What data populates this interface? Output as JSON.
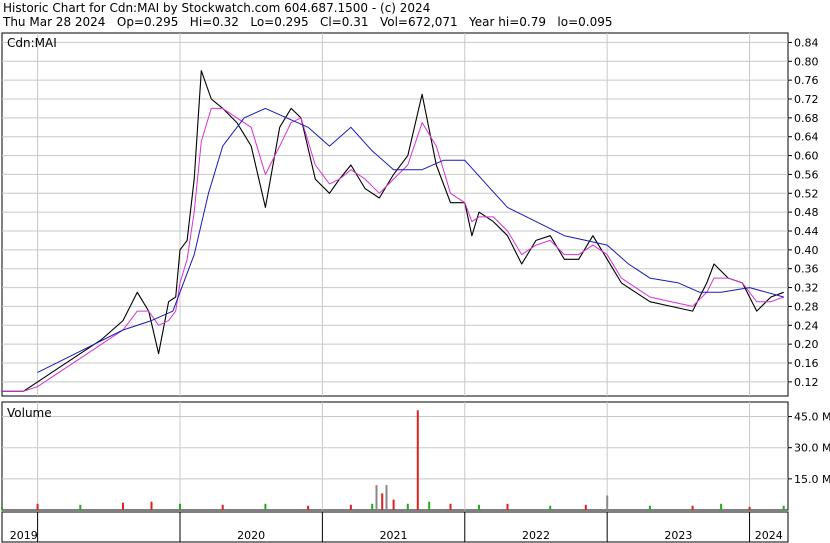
{
  "header": {
    "title": "Historic Chart for Cdn:MAI by Stockwatch.com 604.687.1500 - (c) 2024",
    "quote_line": "Thu Mar 28 2024   Op=0.295   Hi=0.32   Lo=0.295   Cl=0.31   Vol=672,071   Year hi=0.79   lo=0.095"
  },
  "colors": {
    "price": "#000000",
    "ma_short": "#d633d6",
    "ma_long": "#1a1ab8",
    "volume_up": "#22aa22",
    "volume_down": "#dd2222",
    "volume_other": "#888888",
    "grid": "#c8c8c8"
  },
  "chart_data": [
    {
      "type": "line",
      "panel": "price",
      "label": "Cdn:MAI",
      "ylim": [
        0.09,
        0.86
      ],
      "y_ticks": [
        "0.84",
        "0.80",
        "0.76",
        "0.72",
        "0.68",
        "0.64",
        "0.60",
        "0.56",
        "0.52",
        "0.48",
        "0.44",
        "0.40",
        "0.36",
        "0.32",
        "0.28",
        "0.24",
        "0.20",
        "0.16",
        "0.12"
      ],
      "x_ticks": [
        "2019",
        "2020",
        "2021",
        "2022",
        "2023",
        "2024"
      ],
      "series": [
        {
          "key": "close",
          "x": [
            2018.75,
            2018.9,
            2019.0,
            2019.15,
            2019.3,
            2019.45,
            2019.6,
            2019.7,
            2019.78,
            2019.85,
            2019.92,
            2019.97,
            2020.0,
            2020.05,
            2020.1,
            2020.15,
            2020.22,
            2020.3,
            2020.4,
            2020.5,
            2020.6,
            2020.7,
            2020.78,
            2020.85,
            2020.95,
            2021.05,
            2021.12,
            2021.2,
            2021.3,
            2021.4,
            2021.5,
            2021.6,
            2021.7,
            2021.8,
            2021.9,
            2022.0,
            2022.05,
            2022.1,
            2022.2,
            2022.3,
            2022.4,
            2022.5,
            2022.6,
            2022.7,
            2022.8,
            2022.9,
            2023.0,
            2023.1,
            2023.2,
            2023.3,
            2023.45,
            2023.6,
            2023.7,
            2023.75,
            2023.85,
            2023.95,
            2024.05,
            2024.15,
            2024.24
          ],
          "y": [
            0.1,
            0.1,
            0.12,
            0.15,
            0.18,
            0.21,
            0.25,
            0.31,
            0.27,
            0.18,
            0.29,
            0.3,
            0.4,
            0.42,
            0.55,
            0.78,
            0.72,
            0.7,
            0.67,
            0.62,
            0.49,
            0.66,
            0.7,
            0.68,
            0.55,
            0.52,
            0.55,
            0.58,
            0.53,
            0.51,
            0.56,
            0.6,
            0.73,
            0.58,
            0.5,
            0.5,
            0.43,
            0.48,
            0.46,
            0.43,
            0.37,
            0.42,
            0.43,
            0.38,
            0.38,
            0.43,
            0.38,
            0.33,
            0.31,
            0.29,
            0.28,
            0.27,
            0.33,
            0.37,
            0.34,
            0.33,
            0.27,
            0.3,
            0.31
          ]
        },
        {
          "key": "ma_short",
          "x": [
            2018.75,
            2018.9,
            2019.0,
            2019.15,
            2019.3,
            2019.45,
            2019.6,
            2019.7,
            2019.78,
            2019.85,
            2019.92,
            2019.97,
            2020.0,
            2020.05,
            2020.1,
            2020.15,
            2020.22,
            2020.3,
            2020.4,
            2020.5,
            2020.6,
            2020.7,
            2020.78,
            2020.85,
            2020.95,
            2021.05,
            2021.12,
            2021.2,
            2021.3,
            2021.4,
            2021.5,
            2021.6,
            2021.7,
            2021.8,
            2021.9,
            2022.0,
            2022.05,
            2022.1,
            2022.2,
            2022.3,
            2022.4,
            2022.5,
            2022.6,
            2022.7,
            2022.8,
            2022.9,
            2023.0,
            2023.1,
            2023.2,
            2023.3,
            2023.45,
            2023.6,
            2023.7,
            2023.75,
            2023.85,
            2023.95,
            2024.05,
            2024.15,
            2024.24
          ],
          "y": [
            0.1,
            0.1,
            0.11,
            0.14,
            0.17,
            0.2,
            0.23,
            0.27,
            0.27,
            0.24,
            0.25,
            0.27,
            0.33,
            0.38,
            0.48,
            0.63,
            0.7,
            0.7,
            0.68,
            0.66,
            0.56,
            0.62,
            0.67,
            0.68,
            0.58,
            0.54,
            0.55,
            0.57,
            0.55,
            0.52,
            0.55,
            0.58,
            0.67,
            0.62,
            0.52,
            0.5,
            0.46,
            0.47,
            0.47,
            0.44,
            0.39,
            0.41,
            0.42,
            0.39,
            0.39,
            0.41,
            0.39,
            0.34,
            0.32,
            0.3,
            0.29,
            0.28,
            0.31,
            0.34,
            0.34,
            0.33,
            0.29,
            0.29,
            0.3
          ]
        },
        {
          "key": "ma_long",
          "x": [
            2019.0,
            2019.2,
            2019.4,
            2019.6,
            2019.8,
            2019.95,
            2020.1,
            2020.2,
            2020.3,
            2020.45,
            2020.6,
            2020.75,
            2020.9,
            2021.05,
            2021.2,
            2021.35,
            2021.5,
            2021.7,
            2021.85,
            2022.0,
            2022.15,
            2022.3,
            2022.5,
            2022.7,
            2022.85,
            2023.0,
            2023.15,
            2023.3,
            2023.5,
            2023.65,
            2023.8,
            2024.0,
            2024.24
          ],
          "y": [
            0.14,
            0.17,
            0.2,
            0.23,
            0.25,
            0.27,
            0.39,
            0.52,
            0.62,
            0.68,
            0.7,
            0.68,
            0.66,
            0.62,
            0.66,
            0.61,
            0.57,
            0.57,
            0.59,
            0.59,
            0.54,
            0.49,
            0.46,
            0.43,
            0.42,
            0.41,
            0.37,
            0.34,
            0.33,
            0.31,
            0.31,
            0.32,
            0.3
          ]
        }
      ]
    },
    {
      "type": "bar",
      "panel": "volume",
      "label": "Volume",
      "unit": "M",
      "ylim": [
        0,
        52
      ],
      "y_ticks": [
        "45.0 M",
        "30.0 M",
        "15.0 M"
      ],
      "x": [
        2018.75,
        2019.0,
        2019.3,
        2019.6,
        2019.8,
        2020.0,
        2020.3,
        2020.6,
        2020.9,
        2021.2,
        2021.35,
        2021.38,
        2021.42,
        2021.45,
        2021.5,
        2021.6,
        2021.67,
        2021.75,
        2021.9,
        2022.1,
        2022.3,
        2022.6,
        2022.85,
        2023.0,
        2023.3,
        2023.6,
        2023.8,
        2024.0,
        2024.24
      ],
      "values": [
        1.5,
        3.0,
        2.5,
        3.5,
        4.0,
        3.0,
        2.5,
        3.0,
        2.0,
        2.5,
        3.0,
        12.0,
        8.0,
        12.0,
        5.0,
        3.0,
        48.0,
        4.0,
        3.0,
        2.5,
        3.0,
        2.0,
        2.5,
        7.0,
        2.0,
        2.0,
        3.0,
        1.5,
        2.0
      ],
      "colors": [
        "up",
        "down",
        "up",
        "down",
        "down",
        "up",
        "down",
        "up",
        "down",
        "down",
        "up",
        "other",
        "down",
        "other",
        "down",
        "up",
        "down",
        "up",
        "down",
        "up",
        "down",
        "up",
        "down",
        "other",
        "up",
        "down",
        "up",
        "down",
        "up"
      ]
    }
  ]
}
